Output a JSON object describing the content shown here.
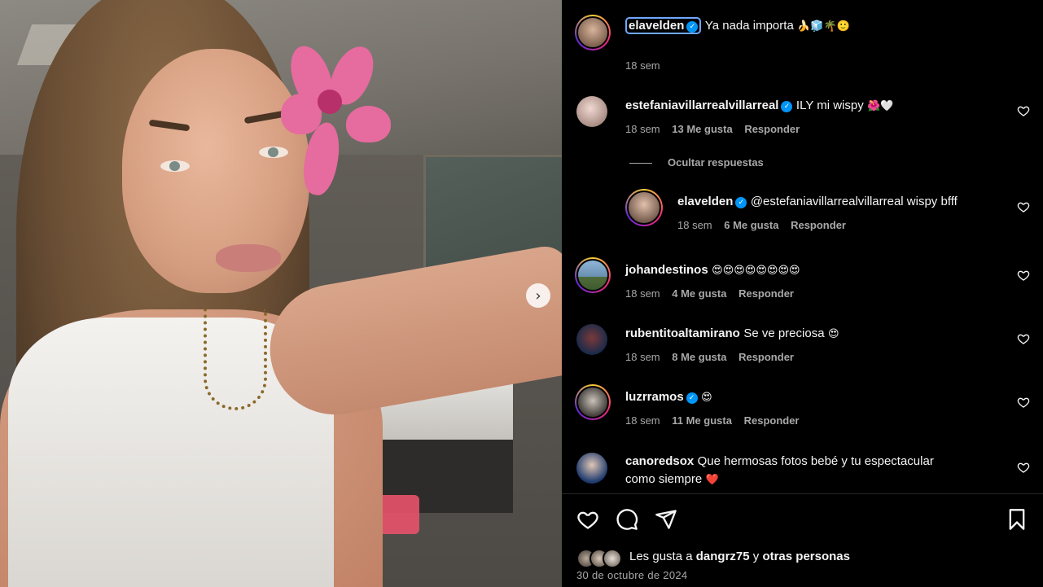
{
  "post": {
    "author": "elavelden",
    "caption": "Ya nada importa",
    "caption_emojis": "🍌🧊🌴🙂",
    "time": "18 sem"
  },
  "comments": [
    {
      "user": "estefaniavillarrealvillarreal",
      "verified": true,
      "text": "ILY mi wispy",
      "emojis": "🌺🤍",
      "time": "18 sem",
      "likes": "13 Me gusta",
      "reply_label": "Responder",
      "hide_replies_label": "Ocultar respuestas"
    },
    {
      "user": "elavelden",
      "verified": true,
      "text": "@estefaniavillarrealvillarreal wispy bfff",
      "time": "18 sem",
      "likes": "6 Me gusta",
      "reply_label": "Responder"
    },
    {
      "user": "johandestinos",
      "text": "",
      "emojis": "😍😍😍😍😍😍😍😍",
      "time": "18 sem",
      "likes": "4 Me gusta",
      "reply_label": "Responder"
    },
    {
      "user": "rubentitoaltamirano",
      "text": "Se ve preciosa",
      "emojis": "😍",
      "time": "18 sem",
      "likes": "8 Me gusta",
      "reply_label": "Responder"
    },
    {
      "user": "luzrramos",
      "verified": true,
      "text": "",
      "emojis": "😍",
      "time": "18 sem",
      "likes": "11 Me gusta",
      "reply_label": "Responder"
    },
    {
      "user": "canoredsox",
      "text_line1": "Que hermosas fotos bebé y tu espectacular",
      "text_line2": "como siempre",
      "emojis": "❤️"
    }
  ],
  "likes": {
    "prefix": "Les gusta a",
    "user": "dangrz75",
    "connector": "y",
    "others": "otras personas"
  },
  "date": "30 de octubre de 2024",
  "icons": {
    "like": "heart-icon",
    "comment": "comment-icon",
    "share": "send-icon",
    "save": "bookmark-icon",
    "next": "chevron-right-icon",
    "verified": "verified-badge-icon"
  },
  "colors": {
    "background": "#000000",
    "text": "#f5f5f5",
    "muted": "#a8a8a8",
    "verified": "#0095f6",
    "focus": "#6fa8ff"
  }
}
